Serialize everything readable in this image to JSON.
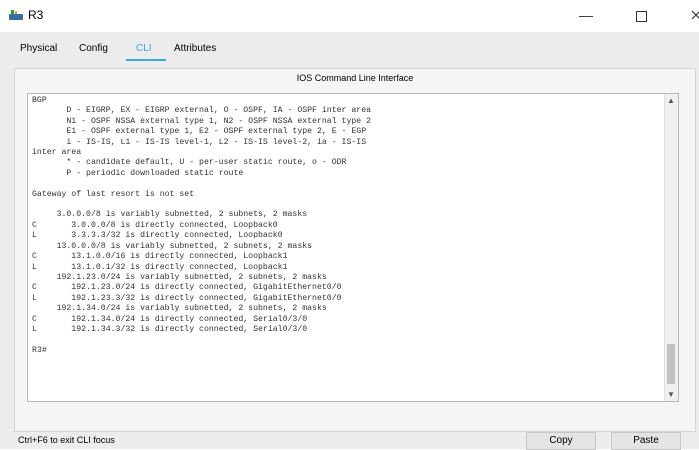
{
  "window": {
    "title": "R3",
    "minimize": "—"
  },
  "tabs": [
    {
      "label": "Physical"
    },
    {
      "label": "Config"
    },
    {
      "label": "CLI"
    },
    {
      "label": "Attributes"
    }
  ],
  "panel": {
    "title": "IOS Command Line Interface"
  },
  "terminal": {
    "text": "BGP\n       D - EIGRP, EX - EIGRP external, O - OSPF, IA - OSPF inter area\n       N1 - OSPF NSSA external type 1, N2 - OSPF NSSA external type 2\n       E1 - OSPF external type 1, E2 - OSPF external type 2, E - EGP\n       i - IS-IS, L1 - IS-IS level-1, L2 - IS-IS level-2, ia - IS-IS\ninter area\n       * - candidate default, U - per-user static route, o - ODR\n       P - periodic downloaded static route\n\nGateway of last resort is not set\n\n     3.0.0.0/8 is variably subnetted, 2 subnets, 2 masks\nC       3.0.0.0/8 is directly connected, Loopback0\nL       3.3.3.3/32 is directly connected, Loopback0\n     13.0.0.0/8 is variably subnetted, 2 subnets, 2 masks\nC       13.1.0.0/16 is directly connected, Loopback1\nL       13.1.0.1/32 is directly connected, Loopback1\n     192.1.23.0/24 is variably subnetted, 2 subnets, 2 masks\nC       192.1.23.0/24 is directly connected, GigabitEthernet0/0\nL       192.1.23.3/32 is directly connected, GigabitEthernet0/0\n     192.1.34.0/24 is variably subnetted, 2 subnets, 2 masks\nC       192.1.34.0/24 is directly connected, Serial0/3/0\nL       192.1.34.3/32 is directly connected, Serial0/3/0\n\nR3#"
  },
  "status": {
    "hint": "Ctrl+F6 to exit CLI focus",
    "copy_label": "Copy",
    "paste_label": "Paste"
  },
  "colors": {
    "accent": "#3ea7e0"
  }
}
